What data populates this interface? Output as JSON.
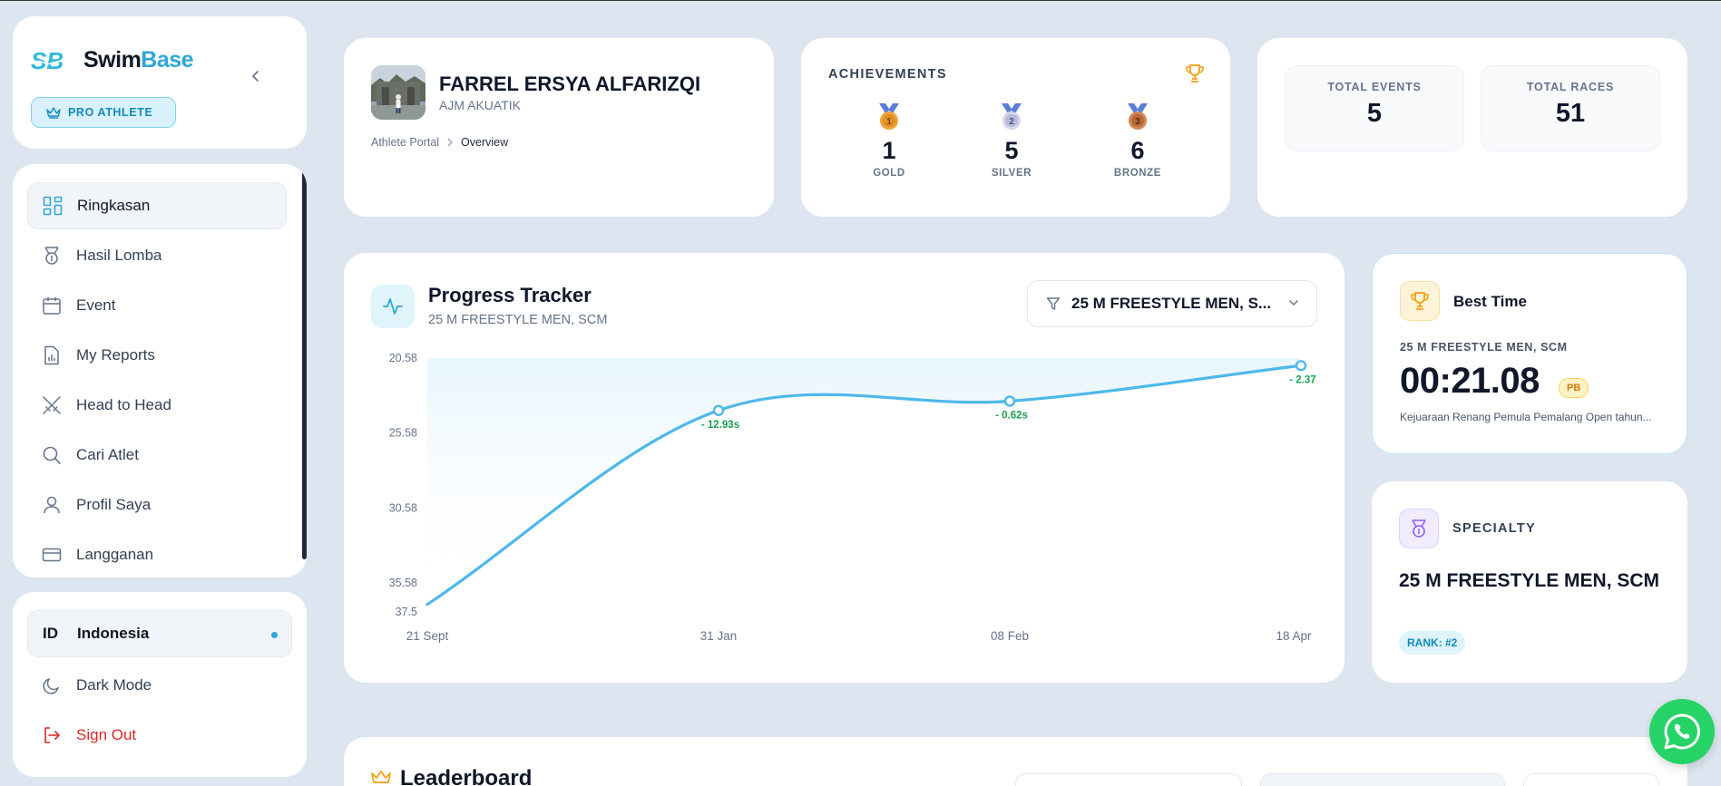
{
  "brand": {
    "name_part1": "Swim",
    "name_part2": "Base",
    "badge": "PRO ATHLETE"
  },
  "sidebar": {
    "items": [
      {
        "label": "Ringkasan",
        "icon": "dashboard-icon",
        "active": true
      },
      {
        "label": "Hasil Lomba",
        "icon": "medal-icon"
      },
      {
        "label": "Event",
        "icon": "calendar-icon"
      },
      {
        "label": "My Reports",
        "icon": "report-icon"
      },
      {
        "label": "Head to Head",
        "icon": "swords-icon"
      },
      {
        "label": "Cari Atlet",
        "icon": "search-icon"
      },
      {
        "label": "Profil Saya",
        "icon": "user-icon"
      },
      {
        "label": "Langganan",
        "icon": "card-icon"
      }
    ]
  },
  "settings": {
    "language_code": "ID",
    "language_name": "Indonesia",
    "dark_mode": "Dark Mode",
    "sign_out": "Sign Out"
  },
  "profile": {
    "name": "FARREL ERSYA ALFARIZQI",
    "club": "AJM AKUATIK",
    "breadcrumb": [
      "Athlete Portal",
      "Overview"
    ]
  },
  "achievements": {
    "title": "ACHIEVEMENTS",
    "medals": [
      {
        "label": "GOLD",
        "count": "1",
        "rank": "1",
        "color": "#f0a23b"
      },
      {
        "label": "SILVER",
        "count": "5",
        "rank": "2",
        "color": "#c7c9e6"
      },
      {
        "label": "BRONZE",
        "count": "6",
        "rank": "3",
        "color": "#c9794a"
      }
    ]
  },
  "totals": {
    "events_label": "TOTAL EVENTS",
    "events_value": "5",
    "races_label": "TOTAL RACES",
    "races_value": "51"
  },
  "progress": {
    "title": "Progress Tracker",
    "subtitle": "25 M FREESTYLE MEN, SCM",
    "filter_value": "25 M FREESTYLE MEN, S..."
  },
  "chart_data": {
    "type": "line",
    "x": [
      "21 Sept",
      "31 Jan",
      "08 Feb",
      "18 Apr"
    ],
    "y": [
      37.0,
      24.07,
      23.45,
      21.08
    ],
    "annotations": [
      "",
      "- 12.93s",
      "- 0.62s",
      "- 2.37"
    ],
    "yticks": [
      "20.58",
      "25.58",
      "30.58",
      "35.58",
      "37.5"
    ],
    "ylim": [
      20.58,
      37.5
    ],
    "y_inverted": true,
    "color": "#4db8ea"
  },
  "best_time": {
    "title": "Best Time",
    "event": "25 M FREESTYLE MEN, SCM",
    "time": "00:21.08",
    "badge": "PB",
    "competition": "Kejuaraan Renang Pemula Pemalang Open tahun..."
  },
  "specialty": {
    "title": "SPECIALTY",
    "event": "25 M FREESTYLE MEN, SCM",
    "rank": "RANK: #2"
  },
  "leaderboard": {
    "title": "Leaderboard"
  },
  "colors": {
    "accent": "#2fa6d6",
    "background": "#dde5f0",
    "danger": "#dc2626"
  }
}
